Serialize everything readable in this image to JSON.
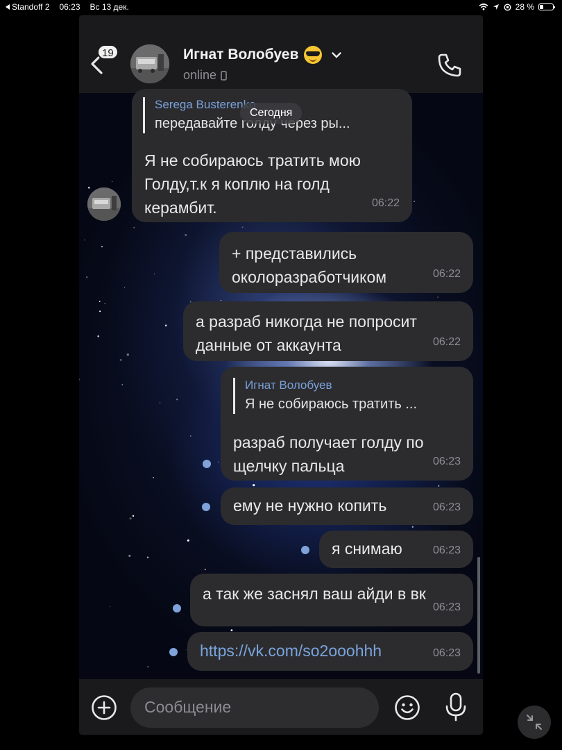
{
  "status_bar": {
    "back_app": "Standoff 2",
    "time": "06:23",
    "date": "Вс 13 дек.",
    "battery": "28 %",
    "battery_level": 0.28
  },
  "header": {
    "unread_badge": "19",
    "contact_name": "Игнат Волобуев",
    "status": "online"
  },
  "date_divider": "Сегодня",
  "messages": [
    {
      "direction": "in",
      "reply": {
        "name": "Serega Busterenko",
        "text": "передавайте голду через ры..."
      },
      "text": "Я не собираюсь тратить мою\nГолду,т.к я коплю на голд\nкерамбит.",
      "time": "06:22"
    },
    {
      "direction": "out",
      "text": "+ представились\nоколоразработчиком",
      "time": "06:22"
    },
    {
      "direction": "out",
      "text": "а разраб никогда не попросит\nданные от аккаунта",
      "time": "06:22"
    },
    {
      "direction": "out",
      "reply": {
        "name": "Игнат Волобуев",
        "text": "Я не собираюсь тратить ..."
      },
      "text": "разраб получает голду по\nщелчку пальца",
      "time": "06:23",
      "unread": true
    },
    {
      "direction": "out",
      "text": "ему не нужно копить",
      "time": "06:23",
      "unread": true
    },
    {
      "direction": "out",
      "text": "я снимаю",
      "time": "06:23",
      "unread": true
    },
    {
      "direction": "out",
      "text": "а так же заснял ваш айди в вк",
      "time": "06:23",
      "unread": true
    },
    {
      "direction": "out",
      "text": "https://vk.com/so2ooohhh",
      "time": "06:23",
      "unread": true,
      "is_link": true
    }
  ],
  "composer": {
    "placeholder": "Сообщение"
  },
  "colors": {
    "accent_link": "#7aa4dd",
    "bubble": "#2c2c2f",
    "header": "#1a1a1c"
  },
  "icons": [
    "back-arrow-icon",
    "phone-icon",
    "plus-icon",
    "sticker-icon",
    "microphone-icon",
    "minimize-icon",
    "chevron-down-icon",
    "mobile-device-icon",
    "wifi-icon",
    "location-icon",
    "battery-icon"
  ]
}
